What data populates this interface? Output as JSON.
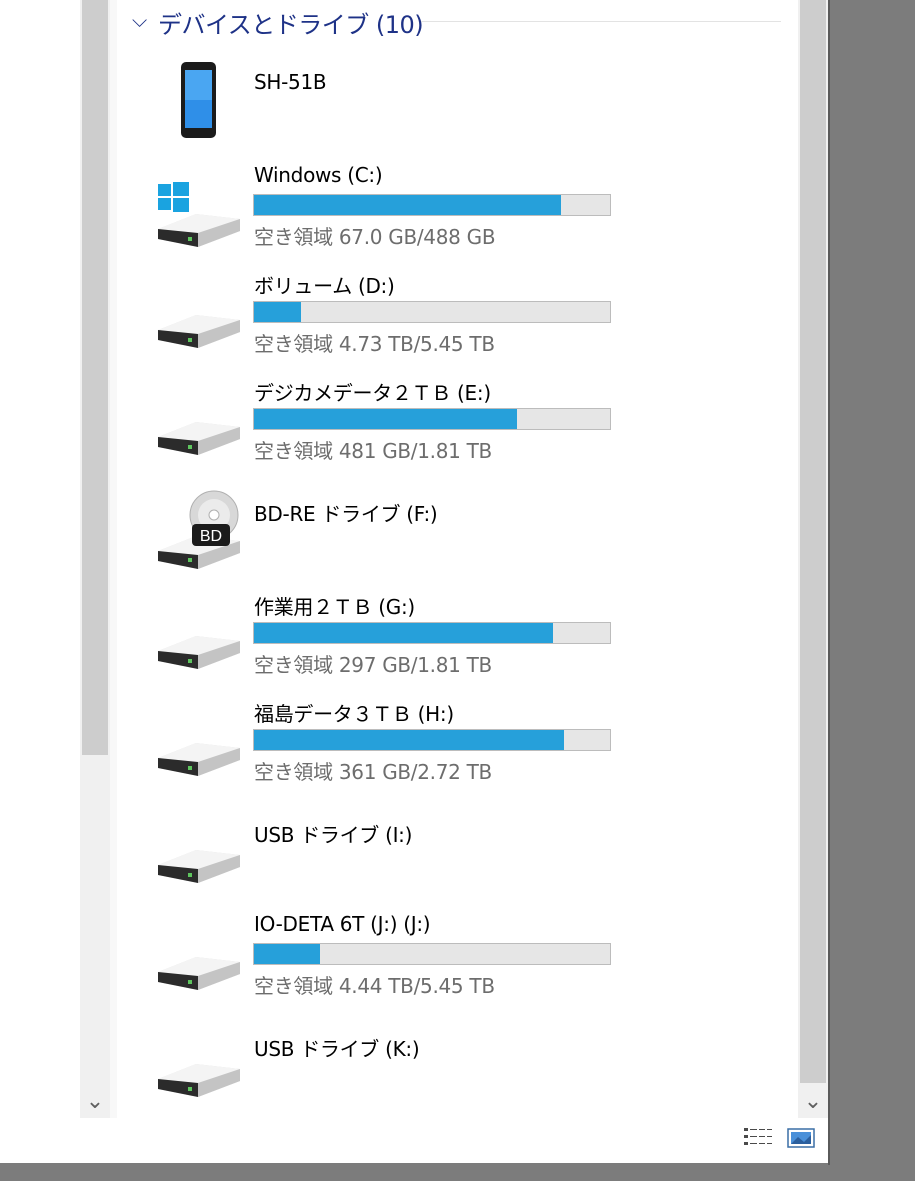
{
  "group": {
    "title": "デバイスとドライブ (10)"
  },
  "items": [
    {
      "name": "SH-51B",
      "icon": "phone-icon"
    },
    {
      "name": "Windows (C:)",
      "free": "空き領域 67.0 GB/488 GB",
      "used_fraction": 0.863,
      "icon": "windows-drive-icon"
    },
    {
      "name": "ボリューム (D:)",
      "free": "空き領域 4.73 TB/5.45 TB",
      "used_fraction": 0.132,
      "icon": "hard-drive-icon"
    },
    {
      "name": "デジカメデータ２ＴＢ (E:)",
      "free": "空き領域 481 GB/1.81 TB",
      "used_fraction": 0.74,
      "icon": "hard-drive-icon"
    },
    {
      "name": "BD-RE ドライブ (F:)",
      "icon": "bd-drive-icon"
    },
    {
      "name": "作業用２ＴＢ (G:)",
      "free": "空き領域 297 GB/1.81 TB",
      "used_fraction": 0.84,
      "icon": "hard-drive-icon"
    },
    {
      "name": "福島データ３ＴＢ (H:)",
      "free": "空き領域 361 GB/2.72 TB",
      "used_fraction": 0.87,
      "icon": "hard-drive-icon"
    },
    {
      "name": "USB ドライブ (I:)",
      "icon": "usb-drive-icon"
    },
    {
      "name": "IO-DETA 6T (J:) (J:)",
      "free": "空き領域 4.44 TB/5.45 TB",
      "used_fraction": 0.185,
      "icon": "hard-drive-icon"
    },
    {
      "name": "USB ドライブ (K:)",
      "icon": "usb-drive-icon"
    }
  ],
  "colors": {
    "bar_fill": "#26a0da",
    "bar_bg": "#e6e6e6",
    "header": "#1e3287"
  }
}
